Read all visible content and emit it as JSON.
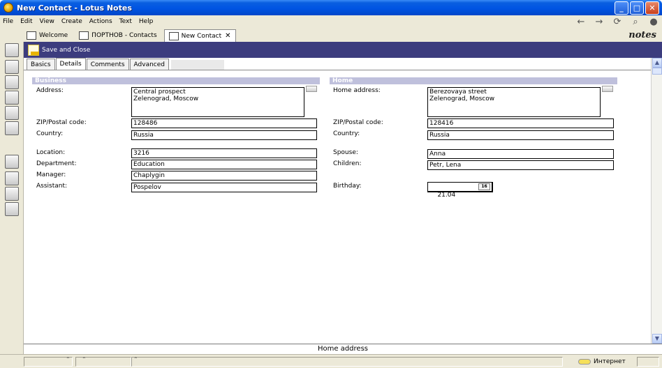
{
  "window": {
    "title": "New Contact - Lotus Notes",
    "controls": [
      "_",
      "□",
      "✕"
    ]
  },
  "menu": [
    "File",
    "Edit",
    "View",
    "Create",
    "Actions",
    "Text",
    "Help"
  ],
  "nav_tools": [
    "←",
    "→",
    "⟳",
    "⌕",
    "●"
  ],
  "window_tabs": [
    {
      "label": "Welcome",
      "active": false
    },
    {
      "label": "ПОРТНОВ - Contacts",
      "active": false
    },
    {
      "label": "New Contact",
      "active": true,
      "close": "✕"
    }
  ],
  "brand": "notes",
  "actionbar": {
    "save_close": "Save and Close"
  },
  "form_tabs": [
    {
      "label": "Basics",
      "active": false
    },
    {
      "label": "Details",
      "active": true
    },
    {
      "label": "Comments",
      "active": false
    },
    {
      "label": "Advanced",
      "active": false
    }
  ],
  "business": {
    "heading": "Business",
    "address_label": "Address:",
    "address_value": "Central prospect\nZelenograd, Moscow",
    "zip_label": "ZIP/Postal code:",
    "zip_value": "128486",
    "country_label": "Country:",
    "country_value": "Russia",
    "location_label": "Location:",
    "location_value": "3216",
    "department_label": "Department:",
    "department_value": "Education",
    "manager_label": "Manager:",
    "manager_value": "Chaplygin",
    "assistant_label": "Assistant:",
    "assistant_value": "Pospelov"
  },
  "home": {
    "heading": "Home",
    "address_label": "Home address:",
    "address_value": "Berezovaya street\nZelenograd, Moscow",
    "zip_label": "ZIP/Postal code:",
    "zip_value": "128416",
    "country_label": "Country:",
    "country_value": "Russia",
    "spouse_label": "Spouse:",
    "spouse_value": "Anna",
    "children_label": "Children:",
    "children_value": "Petr, Lena",
    "birthday_label": "Birthday:",
    "birthday_value": "21.04",
    "calendar_label": "16"
  },
  "field_help": "Home address",
  "status": {
    "zone": "Интернет"
  }
}
